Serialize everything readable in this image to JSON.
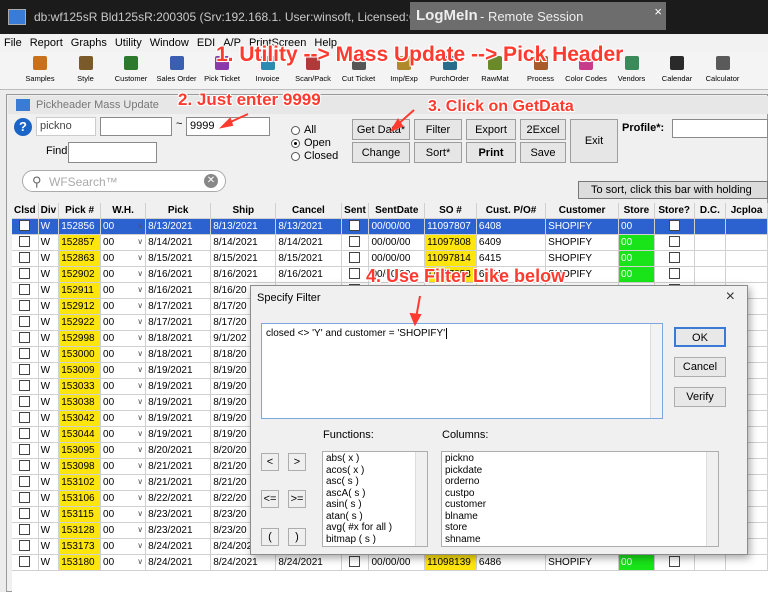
{
  "titlebar": {
    "title": "db:wf125sR Bld125sR:200305 (Srv:192.168.1. User:winsoft, Licensed:GRACIA FASHION"
  },
  "remote": {
    "brand": "LogMeIn",
    "label": "- Remote Session",
    "close": "×"
  },
  "menu": [
    "File",
    "Report",
    "Graphs",
    "Utility",
    "Window",
    "EDI",
    "A/P",
    "PrintScreen",
    "Help"
  ],
  "toolbar": [
    {
      "label": "Samples",
      "color": "#c8711a"
    },
    {
      "label": "Style",
      "color": "#7a5a2a"
    },
    {
      "label": "Customer",
      "color": "#2d7a2d"
    },
    {
      "label": "Sales Order",
      "color": "#3a5fb0"
    },
    {
      "label": "Pick Ticket",
      "color": "#8a3aa8"
    },
    {
      "label": "Invoice",
      "color": "#2a8ab0"
    },
    {
      "label": "Scan/Pack",
      "color": "#b03a3a"
    },
    {
      "label": "Cut Ticket",
      "color": "#555555"
    },
    {
      "label": "Imp/Exp",
      "color": "#b08a2a"
    },
    {
      "label": "PurchOrder",
      "color": "#2a6a8a"
    },
    {
      "label": "RawMat",
      "color": "#6a8a2a"
    },
    {
      "label": "Process",
      "color": "#a85a2a"
    },
    {
      "label": "Color Codes",
      "color": "#c83a8a"
    },
    {
      "label": "Vendors",
      "color": "#3a8a5a"
    },
    {
      "label": "Calendar",
      "color": "#2a2a2a"
    },
    {
      "label": "Calculator",
      "color": "#5a5a5a"
    }
  ],
  "window": {
    "title": "Pickheader Mass Update"
  },
  "search": {
    "field_name": "pickno",
    "value_from": "",
    "tilde": "~",
    "value_to": "9999",
    "find_label": "Find",
    "find_value": ""
  },
  "status_options": {
    "all": "All",
    "open": "Open",
    "closed": "Closed",
    "selected": "Open"
  },
  "buttons": {
    "getdata": "Get Data*",
    "filter": "Filter",
    "export": "Export",
    "excel": "2Excel",
    "change": "Change",
    "sort": "Sort*",
    "print": "Print",
    "save": "Save",
    "exit": "Exit"
  },
  "profile": {
    "label": "Profile*:",
    "value": ""
  },
  "wfsearch": {
    "placeholder": "WFSearch™"
  },
  "sortbar": {
    "text": "To sort, click this bar with holding"
  },
  "grid": {
    "columns": [
      "Clsd",
      "Div",
      "Pick #",
      "W.H.",
      "Pick",
      "Ship",
      "Cancel",
      "Sent",
      "SentDate",
      "SO #",
      "Cust. P/O#",
      "Customer",
      "Store",
      "Store?",
      "D.C.",
      "Jcploa"
    ],
    "rows": [
      {
        "div": "W",
        "pick": "152856",
        "wh": "00",
        "pickdate": "8/13/2021",
        "ship": "8/13/2021",
        "cancel": "8/13/2021",
        "sentdate": "00/00/00",
        "so": "11097807",
        "po": "6408",
        "customer": "SHOPIFY",
        "store": "00"
      },
      {
        "div": "W",
        "pick": "152857",
        "wh": "00",
        "pickdate": "8/14/2021",
        "ship": "8/14/2021",
        "cancel": "8/14/2021",
        "sentdate": "00/00/00",
        "so": "11097808",
        "po": "6409",
        "customer": "SHOPIFY",
        "store": "00"
      },
      {
        "div": "W",
        "pick": "152863",
        "wh": "00",
        "pickdate": "8/15/2021",
        "ship": "8/15/2021",
        "cancel": "8/15/2021",
        "sentdate": "00/00/00",
        "so": "11097814",
        "po": "6415",
        "customer": "SHOPIFY",
        "store": "00"
      },
      {
        "div": "W",
        "pick": "152902",
        "wh": "00",
        "pickdate": "8/16/2021",
        "ship": "8/16/2021",
        "cancel": "8/16/2021",
        "sentdate": "00/00/00",
        "so": "11097853",
        "po": "6454",
        "customer": "SHOPIFY",
        "store": "00"
      },
      {
        "div": "W",
        "pick": "152911",
        "wh": "00",
        "pickdate": "8/16/2021",
        "ship": "8/16/20",
        "cancel": "",
        "sentdate": "",
        "so": "",
        "po": "",
        "customer": "",
        "store": ""
      },
      {
        "div": "W",
        "pick": "152912",
        "wh": "00",
        "pickdate": "8/17/2021",
        "ship": "8/17/20",
        "cancel": "",
        "sentdate": "",
        "so": "",
        "po": "",
        "customer": "",
        "store": ""
      },
      {
        "div": "W",
        "pick": "152922",
        "wh": "00",
        "pickdate": "8/17/2021",
        "ship": "8/17/20",
        "cancel": "",
        "sentdate": "",
        "so": "",
        "po": "",
        "customer": "",
        "store": ""
      },
      {
        "div": "W",
        "pick": "152998",
        "wh": "00",
        "pickdate": "8/18/2021",
        "ship": "9/1/202",
        "cancel": "",
        "sentdate": "",
        "so": "",
        "po": "",
        "customer": "",
        "store": ""
      },
      {
        "div": "W",
        "pick": "153000",
        "wh": "00",
        "pickdate": "8/18/2021",
        "ship": "8/18/20",
        "cancel": "",
        "sentdate": "",
        "so": "",
        "po": "",
        "customer": "",
        "store": ""
      },
      {
        "div": "W",
        "pick": "153009",
        "wh": "00",
        "pickdate": "8/19/2021",
        "ship": "8/19/20",
        "cancel": "",
        "sentdate": "",
        "so": "",
        "po": "",
        "customer": "",
        "store": ""
      },
      {
        "div": "W",
        "pick": "153033",
        "wh": "00",
        "pickdate": "8/19/2021",
        "ship": "8/19/20",
        "cancel": "",
        "sentdate": "",
        "so": "",
        "po": "",
        "customer": "",
        "store": ""
      },
      {
        "div": "W",
        "pick": "153038",
        "wh": "00",
        "pickdate": "8/19/2021",
        "ship": "8/19/20",
        "cancel": "",
        "sentdate": "",
        "so": "",
        "po": "",
        "customer": "",
        "store": ""
      },
      {
        "div": "W",
        "pick": "153042",
        "wh": "00",
        "pickdate": "8/19/2021",
        "ship": "8/19/20",
        "cancel": "",
        "sentdate": "",
        "so": "",
        "po": "",
        "customer": "",
        "store": ""
      },
      {
        "div": "W",
        "pick": "153044",
        "wh": "00",
        "pickdate": "8/19/2021",
        "ship": "8/19/20",
        "cancel": "",
        "sentdate": "",
        "so": "",
        "po": "",
        "customer": "",
        "store": ""
      },
      {
        "div": "W",
        "pick": "153095",
        "wh": "00",
        "pickdate": "8/20/2021",
        "ship": "8/20/20",
        "cancel": "",
        "sentdate": "",
        "so": "",
        "po": "",
        "customer": "",
        "store": ""
      },
      {
        "div": "W",
        "pick": "153098",
        "wh": "00",
        "pickdate": "8/21/2021",
        "ship": "8/21/20",
        "cancel": "",
        "sentdate": "",
        "so": "",
        "po": "",
        "customer": "",
        "store": ""
      },
      {
        "div": "W",
        "pick": "153102",
        "wh": "00",
        "pickdate": "8/21/2021",
        "ship": "8/21/20",
        "cancel": "",
        "sentdate": "",
        "so": "",
        "po": "",
        "customer": "",
        "store": ""
      },
      {
        "div": "W",
        "pick": "153106",
        "wh": "00",
        "pickdate": "8/22/2021",
        "ship": "8/22/20",
        "cancel": "",
        "sentdate": "",
        "so": "",
        "po": "",
        "customer": "",
        "store": ""
      },
      {
        "div": "W",
        "pick": "153115",
        "wh": "00",
        "pickdate": "8/23/2021",
        "ship": "8/23/20",
        "cancel": "",
        "sentdate": "",
        "so": "",
        "po": "",
        "customer": "",
        "store": ""
      },
      {
        "div": "W",
        "pick": "153128",
        "wh": "00",
        "pickdate": "8/23/2021",
        "ship": "8/23/20",
        "cancel": "",
        "sentdate": "",
        "so": "",
        "po": "",
        "customer": "",
        "store": ""
      },
      {
        "div": "W",
        "pick": "153173",
        "wh": "00",
        "pickdate": "8/24/2021",
        "ship": "8/24/2021",
        "cancel": "8/24/2021",
        "sentdate": "00/00/00",
        "so": "11098133",
        "po": "6484",
        "customer": "SHOPIFY",
        "store": "00"
      },
      {
        "div": "W",
        "pick": "153180",
        "wh": "00",
        "pickdate": "8/24/2021",
        "ship": "8/24/2021",
        "cancel": "8/24/2021",
        "sentdate": "00/00/00",
        "so": "11098139",
        "po": "6486",
        "customer": "SHOPIFY",
        "store": "00"
      }
    ]
  },
  "dialog": {
    "title": "Specify Filter",
    "close": "×",
    "expression": "closed <> 'Y'  and  customer = 'SHOPIFY'",
    "ok": "OK",
    "cancel": "Cancel",
    "verify": "Verify",
    "functions_label": "Functions:",
    "columns_label": "Columns:",
    "op_lt": "<",
    "op_gt": ">",
    "op_le": "<=",
    "op_ge": ">=",
    "op_lp": "(",
    "op_rp": ")",
    "functions": [
      "abs( x )",
      "acos( x )",
      "asc( s )",
      "ascA( s )",
      "asin( s )",
      "atan( s )",
      "avg( #x for all )",
      "bitmap ( s )"
    ],
    "columns": [
      "pickno",
      "pickdate",
      "orderno",
      "custpo",
      "customer",
      "blname",
      "store",
      "shname"
    ]
  },
  "annotations": {
    "step1": "1. Utility --> Mass Update --> Pick Header",
    "step2": "2. Just enter 9999",
    "step3": "3.  Click on GetData",
    "step4": "4. Use Filter Like below",
    "color": "#ff3a2f"
  }
}
